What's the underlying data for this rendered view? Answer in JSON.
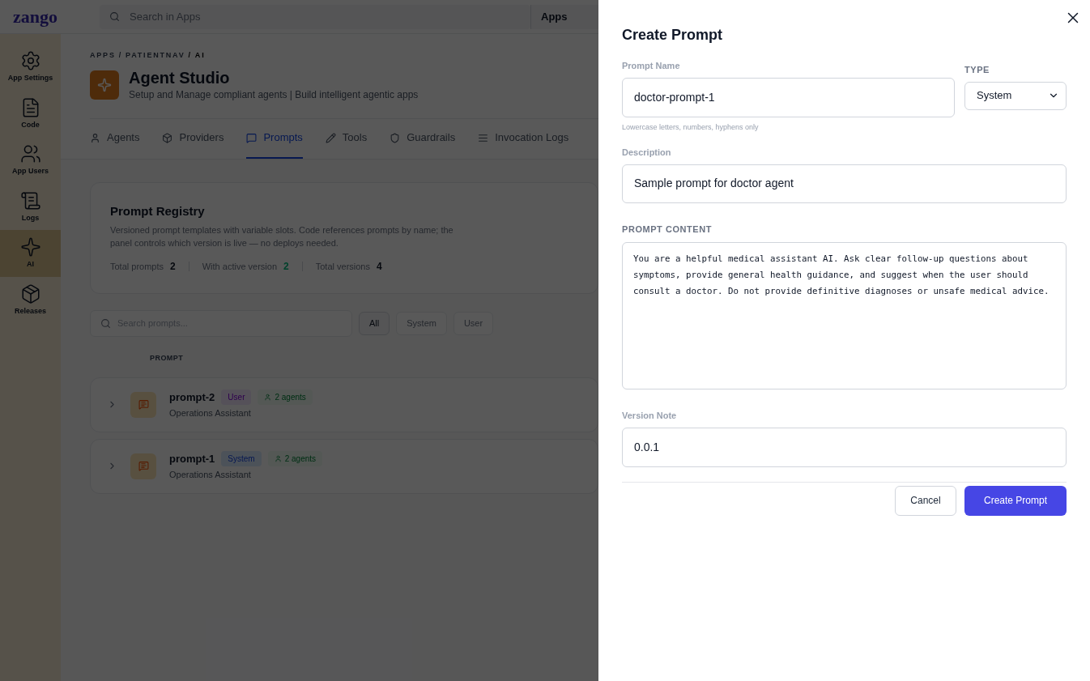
{
  "topbar": {
    "logo": "zango",
    "search": {
      "placeholder": "Search in Apps"
    },
    "apps_label": "Apps"
  },
  "sidebar": {
    "items": [
      {
        "label": "App Settings",
        "selected": false
      },
      {
        "label": "Code",
        "selected": false
      },
      {
        "label": "App Users",
        "selected": false
      },
      {
        "label": "Logs",
        "selected": false
      },
      {
        "label": "AI",
        "selected": true
      },
      {
        "label": "Releases",
        "selected": false
      }
    ]
  },
  "breadcrumb": [
    {
      "label": "APPS",
      "current": false
    },
    {
      "label": "/",
      "current": false
    },
    {
      "label": "PATIENTNAV",
      "current": false
    },
    {
      "label": "/",
      "current": true
    },
    {
      "label": "AI",
      "current": true
    }
  ],
  "header": {
    "title": "Agent Studio",
    "subtitle": "Setup and Manage compliant agents | Build intelligent agentic apps"
  },
  "tabs": [
    {
      "label": "Agents",
      "selected": false
    },
    {
      "label": "Providers",
      "selected": false
    },
    {
      "label": "Prompts",
      "selected": true
    },
    {
      "label": "Tools",
      "selected": false
    },
    {
      "label": "Guardrails",
      "selected": false
    },
    {
      "label": "Invocation Logs",
      "selected": false
    }
  ],
  "registry": {
    "title": "Prompt Registry",
    "description": "Versioned prompt templates with variable slots. Code references prompts by name; the panel controls which version is live — no deploys needed.",
    "stats": [
      {
        "label": "Total prompts",
        "value": "2",
        "kind": "count"
      },
      {
        "label": "With active version",
        "value": "2",
        "kind": "active"
      },
      {
        "label": "Total versions",
        "value": "4",
        "kind": "count"
      }
    ]
  },
  "filter": {
    "search": {
      "placeholder": "Search prompts..."
    },
    "chips": [
      {
        "label": "All",
        "selected": true
      },
      {
        "label": "System",
        "selected": false
      },
      {
        "label": "User",
        "selected": false
      }
    ]
  },
  "table": {
    "columns": [
      "PROMPT"
    ],
    "rows": [
      {
        "name": "prompt-2",
        "type": {
          "label": "User",
          "kind": "user"
        },
        "agents": "2 agents",
        "description": "Operations Assistant"
      },
      {
        "name": "prompt-1",
        "type": {
          "label": "System",
          "kind": "system"
        },
        "agents": "2 agents",
        "description": "Operations Assistant"
      }
    ]
  },
  "dialog": {
    "title": "Create Prompt",
    "name_field": {
      "label": "Prompt Name",
      "value": "doctor-prompt-1",
      "hint": "Lowercase letters, numbers, hyphens only"
    },
    "type_field": {
      "label": "TYPE",
      "value": "System"
    },
    "description_field": {
      "label": "Description",
      "value": "Sample prompt for doctor agent"
    },
    "content_field": {
      "label": "PROMPT CONTENT",
      "value": "You are a helpful medical assistant AI. Ask clear follow-up questions about symptoms, provide general health guidance, and suggest when the user should consult a doctor. Do not provide definitive diagnoses or unsafe medical advice."
    },
    "version_field": {
      "label": "Version Note",
      "value": "0.0.1"
    },
    "buttons": [
      {
        "label": "Cancel",
        "kind": "secondary"
      },
      {
        "label": "Create Prompt",
        "kind": "primary"
      }
    ]
  }
}
